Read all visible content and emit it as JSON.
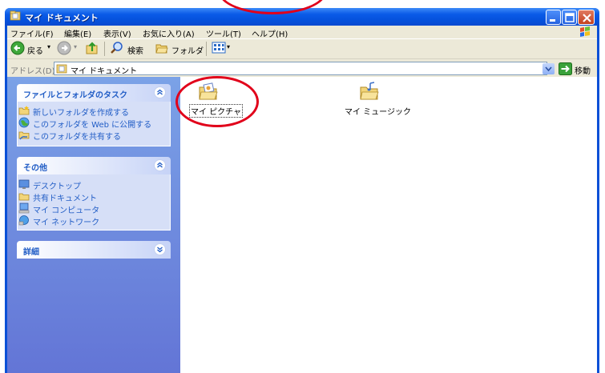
{
  "window": {
    "title": "マイ ドキュメント"
  },
  "menu": [
    "ファイル(F)",
    "編集(E)",
    "表示(V)",
    "お気に入り(A)",
    "ツール(T)",
    "ヘルプ(H)"
  ],
  "toolbar": {
    "back_label": "戻る",
    "search_label": "検索",
    "folders_label": "フォルダ"
  },
  "address": {
    "label": "アドレス(D)",
    "value": "マイ ドキュメント",
    "go_label": "移動"
  },
  "tasks_panel": {
    "title": "ファイルとフォルダのタスク",
    "items": [
      "新しいフォルダを作成する",
      "このフォルダを Web に公開する",
      "このフォルダを共有する"
    ]
  },
  "other_panel": {
    "title": "その他",
    "items": [
      "デスクトップ",
      "共有ドキュメント",
      "マイ コンピュータ",
      "マイ ネットワーク"
    ]
  },
  "details_panel": {
    "title": "詳細"
  },
  "folders": [
    {
      "label": "マイ ピクチャ",
      "icon": "my-pictures-folder-icon",
      "selected": true
    },
    {
      "label": "マイ ミュージック",
      "icon": "my-music-folder-icon",
      "selected": false
    }
  ],
  "colors": {
    "titlebar": "#0a5be8",
    "task_link": "#215dc6",
    "panel_background": "#d6dff7",
    "annotation_circle": "#e1001a"
  }
}
